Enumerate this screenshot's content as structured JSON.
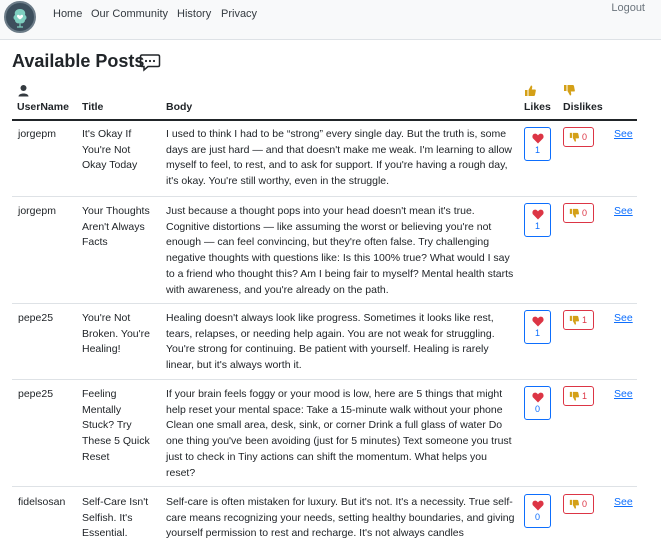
{
  "nav": {
    "links": [
      "Home",
      "Our Community",
      "History",
      "Privacy"
    ],
    "logout": "Logout"
  },
  "page": {
    "title": "Available Posts"
  },
  "table": {
    "headers": {
      "user": "UserName",
      "title": "Title",
      "body": "Body",
      "likes": "Likes",
      "dislikes": "Dislikes"
    },
    "see_label": "See",
    "rows": [
      {
        "user": "jorgepm",
        "title": "It's Okay If You're Not Okay Today",
        "body": "I used to think I had to be “strong” every single day. But the truth is, some days are just hard — and that doesn't make me weak. I'm learning to allow myself to feel, to rest, and to ask for support. If you're having a rough day, it's okay. You're still worthy, even in the struggle.",
        "likes": 1,
        "dislikes": 0
      },
      {
        "user": "jorgepm",
        "title": "Your Thoughts Aren't Always Facts",
        "body": "Just because a thought pops into your head doesn't mean it's true. Cognitive distortions — like assuming the worst or believing you're not enough — can feel convincing, but they're often false. Try challenging negative thoughts with questions like: Is this 100% true? What would I say to a friend who thought this? Am I being fair to myself? Mental health starts with awareness, and you're already on the path.",
        "likes": 1,
        "dislikes": 0
      },
      {
        "user": "pepe25",
        "title": "You're Not Broken. You're Healing!",
        "body": "Healing doesn't always look like progress. Sometimes it looks like rest, tears, relapses, or needing help again. You are not weak for struggling. You're strong for continuing. Be patient with yourself. Healing is rarely linear, but it's always worth it.",
        "likes": 1,
        "dislikes": 1
      },
      {
        "user": "pepe25",
        "title": "Feeling Mentally Stuck? Try These 5 Quick Reset",
        "body": "If your brain feels foggy or your mood is low, here are 5 things that might help reset your mental space: Take a 15-minute walk without your phone Clean one small area, desk, sink, or corner Drink a full glass of water Do one thing you've been avoiding (just for 5 minutes) Text someone you trust just to check in Tiny actions can shift the momentum. What helps you reset?",
        "likes": 0,
        "dislikes": 1
      },
      {
        "user": "fidelsosan",
        "title": "Self-Care Isn't Selfish. It's Essential.",
        "body": "Self-care is often mistaken for luxury. But it's not. It's a necessity. True self-care means recognizing your needs, setting healthy boundaries, and giving yourself permission to rest and recharge. It's not always candles",
        "likes": 0,
        "dislikes": 0
      }
    ]
  },
  "colors": {
    "like": "#dc3545",
    "like_border": "#0d6efd",
    "dislike_icon": "#d4a017",
    "dislike_border": "#dc3545",
    "link": "#0d6efd"
  },
  "icons": {
    "logo": "brain-heart-logo",
    "title": "chat-bubble-icon",
    "user": "person-icon",
    "likes": "thumbs-up-icon",
    "dislikes": "thumbs-down-icon",
    "like_button": "heart-icon",
    "dislike_button": "thumbs-down-icon"
  }
}
